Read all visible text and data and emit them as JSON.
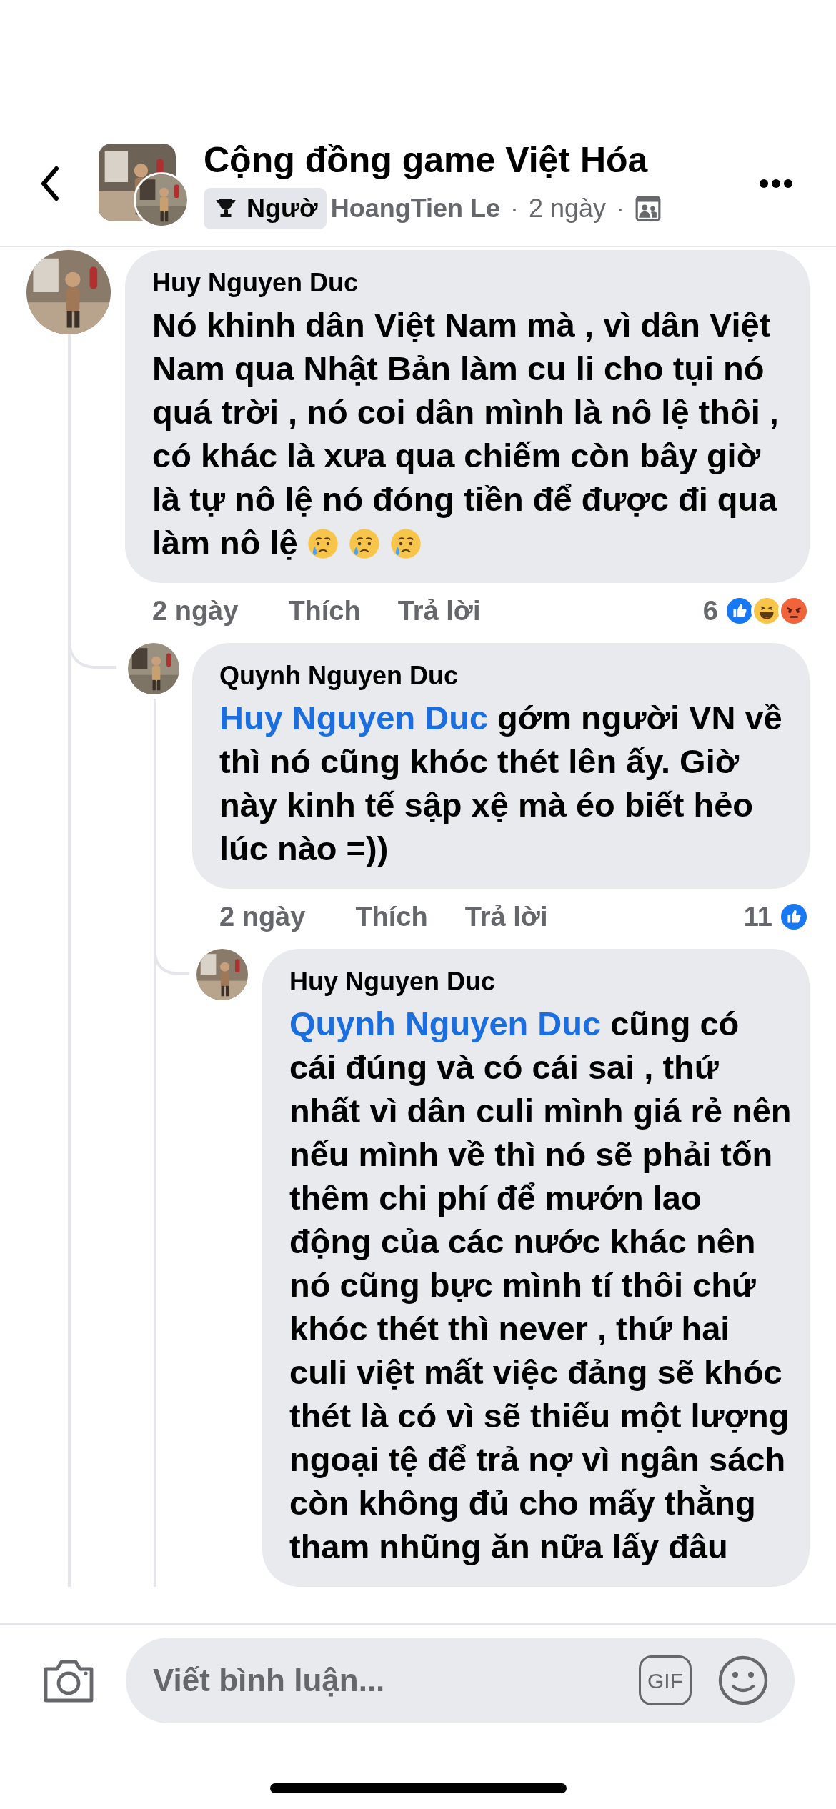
{
  "header": {
    "title": "Cộng đồng game Việt Hóa",
    "badge": "Ngườ",
    "author": "HoangTien Le",
    "separator": "·",
    "time": "2 ngày"
  },
  "comments": [
    {
      "name": "Huy Nguyen Duc",
      "text": "Nó khinh dân Việt Nam mà , vì dân Việt Nam qua Nhật Bản làm cu li cho tụi nó quá trời , nó coi dân mình là nô lệ thôi , có khác là xưa qua chiếm còn bây giờ là tự nô lệ nó đóng tiền để được đi qua làm nô lệ",
      "emojis": [
        {
          "kind": "crying"
        },
        {
          "kind": "crying"
        },
        {
          "kind": "crying"
        }
      ],
      "time": "2 ngày",
      "like": "Thích",
      "reply": "Trả lời",
      "reaction_count": "6",
      "reactions": [
        {
          "kind": "like"
        },
        {
          "kind": "haha"
        },
        {
          "kind": "angry"
        }
      ],
      "replies": [
        {
          "name": "Quynh Nguyen Duc",
          "mention": "Huy Nguyen Duc",
          "text": "gớm người VN về thì nó cũng khóc thét lên ấy. Giờ này kinh tế sập xệ mà éo biết hẻo lúc nào =))",
          "time": "2 ngày",
          "like": "Thích",
          "reply": "Trả lời",
          "reaction_count": "11",
          "reactions": [
            {
              "kind": "like"
            }
          ],
          "replies": [
            {
              "name": "Huy Nguyen Duc",
              "mention": "Quynh Nguyen Duc",
              "text": "cũng có cái đúng và có cái sai , thứ nhất vì dân culi mình giá rẻ nên nếu mình về thì nó sẽ phải tốn thêm chi phí để mướn lao động của các nước khác nên nó cũng bực mình tí thôi chứ khóc thét thì never , thứ hai culi việt mất việc đảng sẽ khóc thét là có vì sẽ thiếu một lượng ngoại tệ để trả nợ vì ngân sách còn không đủ cho mấy thằng tham nhũng ăn nữa lấy đâu"
            }
          ]
        }
      ]
    }
  ],
  "composer": {
    "placeholder": "Viết bình luận...",
    "gif": "GIF"
  }
}
